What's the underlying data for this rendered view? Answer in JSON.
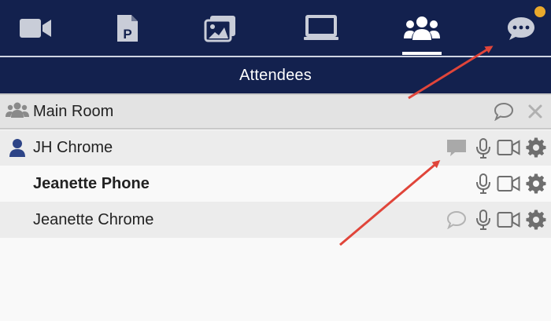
{
  "toolbar": {
    "tools": [
      {
        "icon": "video-camera-icon",
        "label": ""
      },
      {
        "icon": "powerpoint-file-icon",
        "label": ""
      },
      {
        "icon": "images-icon",
        "label": ""
      },
      {
        "icon": "screen-share-icon",
        "label": ""
      },
      {
        "icon": "attendees-group-icon",
        "label": "",
        "active": true
      },
      {
        "icon": "chat-icon",
        "label": "",
        "notification": true
      }
    ]
  },
  "panel": {
    "title": "Attendees"
  },
  "rooms": [
    {
      "name": "Main Room",
      "icon": "group-icon"
    }
  ],
  "attendees": [
    {
      "name": "JH Chrome",
      "self": true,
      "bold": false,
      "chat_state": "active"
    },
    {
      "name": "Jeanette Phone",
      "self": false,
      "bold": true,
      "chat_state": "none"
    },
    {
      "name": "Jeanette Chrome",
      "self": false,
      "bold": false,
      "chat_state": "outline"
    }
  ],
  "colors": {
    "navy": "#13214e",
    "badge": "#e9a92c",
    "icon_gray": "#8c8c8c",
    "annotation_red": "#e0453a"
  }
}
